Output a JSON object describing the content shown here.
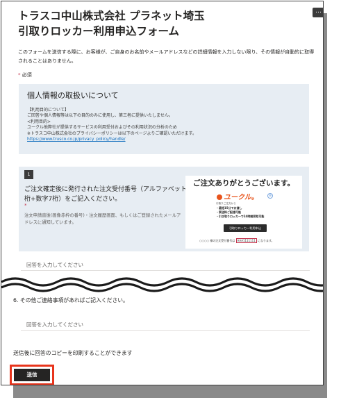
{
  "form": {
    "title_line1": "トラスコ中山株式会社 プラネット埼玉",
    "title_line2": "引取りロッカー利用申込フォーム",
    "more_label": "…",
    "description": "このフォームを送信する際に、お客様が、ご自身のお名前やメールアドレスなどの詳細情報を入力しない限り、その情報が自動的に取得されることはありません。",
    "required_star": "*",
    "required_label": "必須"
  },
  "privacy": {
    "heading": "個人情報の取扱いについて",
    "line1": "【利用目的について】",
    "line2": "ご回答や個人情報等は以下の目的のみに使用し、第三者に提供いたしません。",
    "line3": "<利用目的>",
    "line4": "ユークル他弊社が提供するサービスの利用受付およびその利用状況の分析のため",
    "line5": "※トラスコ中山株式会社のプライバシーポリシーは以下のページよりご確認いただけます。",
    "link": "https://www.trusco.co.jp/privacy_policy/handle/"
  },
  "question1": {
    "number": "1",
    "title": "ご注文確定後に発行された注文受付番号（アルファベット3桁+数字7桁）をご記入ください。",
    "star": "*",
    "note": "注文申請直後(画像赤枠の番号)・注文履歴画面、もしくはご登録されたメールアドレスに通知しています。",
    "input_placeholder": "回答を入力してください"
  },
  "promo_image": {
    "heading": "ご注文ありがとうございます。",
    "logo": "ユークル。",
    "logo_badge": "⊗",
    "sub": "引取りご注文から",
    "bullets": [
      "・最短15分でお渡し",
      "・家送料ご配達可能",
      "・引き取りロッカーで24時間受取可能"
    ],
    "button": "引取りロッカー利用申込",
    "order_prefix": "○○○○ 様の注文受付番号は",
    "order_number": "AAA1111111",
    "order_suffix": "になります。"
  },
  "question6": {
    "label": "6. その他ご連絡事項があればご記入ください。",
    "input_placeholder": "回答を入力してください"
  },
  "footer": {
    "print_note": "送信後に回答のコピーを印刷することができます",
    "submit_label": "送信"
  },
  "colors": {
    "accent_dark": "#252423",
    "section_bg": "#e7edf3",
    "required": "#c4314b",
    "highlight_frame": "#e8341c",
    "link": "#0f6cbd"
  }
}
